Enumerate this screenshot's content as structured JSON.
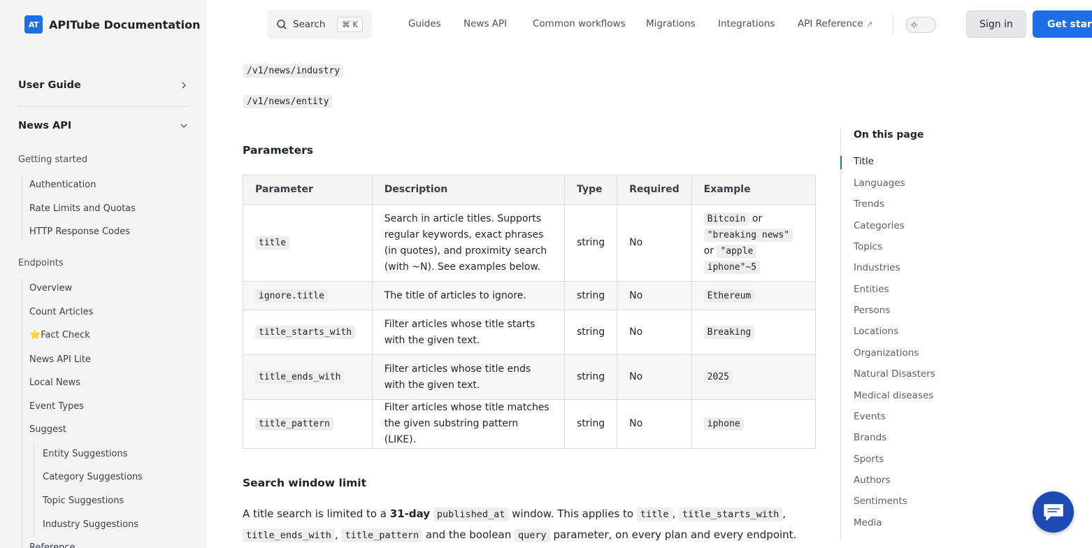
{
  "brand": {
    "logo": "AT",
    "title": "APITube Documentation"
  },
  "sidebar": {
    "user_guide": "User Guide",
    "news_api": "News API",
    "getting_started": "Getting started",
    "getting_started_items": [
      "Authentication",
      "Rate Limits and Quotas",
      "HTTP Response Codes"
    ],
    "endpoints": "Endpoints",
    "endpoint_items": [
      "Overview",
      "Count Articles",
      "Fact Check",
      "News API Lite",
      "Local News",
      "Event Types",
      "Suggest"
    ],
    "fact_check_prefix": "⭐",
    "suggest_items": [
      "Entity Suggestions",
      "Category Suggestions",
      "Topic Suggestions",
      "Industry Suggestions"
    ],
    "reference": "Reference"
  },
  "topbar": {
    "search_label": "Search",
    "search_shortcut": "⌘ K",
    "nav": [
      "Guides",
      "News API",
      "Common workflows",
      "Migrations",
      "Integrations",
      "API Reference"
    ],
    "external_arrow": "↗",
    "sign_in": "Sign in",
    "get_started": "Get started"
  },
  "main": {
    "endpoints": [
      "/v1/news/industry",
      "/v1/news/entity"
    ],
    "params_heading": "Parameters",
    "table": {
      "headers": [
        "Parameter",
        "Description",
        "Type",
        "Required",
        "Example"
      ],
      "rows": [
        {
          "param": "title",
          "description": "Search in article titles. Supports regular keywords, exact phrases (in quotes), and proximity search (with ~N). See examples below.",
          "type": "string",
          "required": "No",
          "ex1": "Bitcoin",
          "or1": "or",
          "ex2": "\"breaking news\"",
          "or2": "or",
          "ex3": "\"apple",
          "ex4": "iphone\"~5"
        },
        {
          "param": "ignore.title",
          "description": "The title of articles to ignore.",
          "type": "string",
          "required": "No",
          "example": "Ethereum"
        },
        {
          "param": "title_starts_with",
          "description": "Filter articles whose title starts with the given text.",
          "type": "string",
          "required": "No",
          "example": "Breaking"
        },
        {
          "param": "title_ends_with",
          "description": "Filter articles whose title ends with the given text.",
          "type": "string",
          "required": "No",
          "example": "2025"
        },
        {
          "param": "title_pattern",
          "description": "Filter articles whose title matches the given substring pattern (LIKE).",
          "type": "string",
          "required": "No",
          "example": "iphone"
        }
      ]
    },
    "window_heading": "Search window limit",
    "window_para": {
      "t1": "A title search is limited to a ",
      "bold": "31-day",
      "c1": "published_at",
      "t2": " window. This applies to ",
      "c2": "title",
      "sep1": ", ",
      "c3": "title_starts_with",
      "sep2": ",",
      "c4": "title_ends_with",
      "sep3": ", ",
      "c5": "title_pattern",
      "t3": " and the boolean ",
      "c6": "query",
      "t4": " parameter, on every plan and every endpoint."
    }
  },
  "toc": {
    "title": "On this page",
    "items": [
      "Title",
      "Languages",
      "Trends",
      "Categories",
      "Topics",
      "Industries",
      "Entities",
      "Persons",
      "Locations",
      "Organizations",
      "Natural Disasters",
      "Medical diseases",
      "Events",
      "Brands",
      "Sports",
      "Authors",
      "Sentiments",
      "Media"
    ]
  },
  "colors": {
    "accent": "#1c6fe8",
    "toc_active": "#1a7d8a",
    "chat": "#1d4bb3"
  },
  "icons": {
    "search": "search-icon",
    "theme": "sun-icon",
    "chat": "chat-icon",
    "chevron_right": "chevron-right-icon",
    "chevron_down": "chevron-down-icon"
  }
}
